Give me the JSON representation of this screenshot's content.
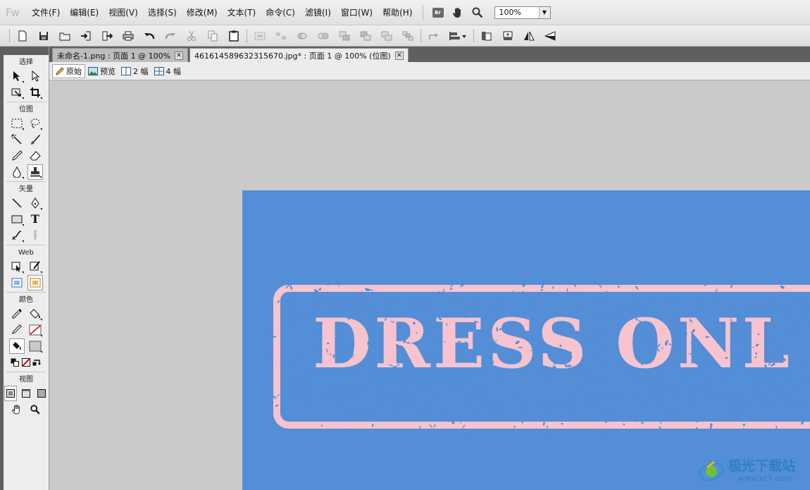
{
  "app": {
    "logo": "Fw"
  },
  "menubar": {
    "items": [
      {
        "label": "文件(F)"
      },
      {
        "label": "编辑(E)"
      },
      {
        "label": "视图(V)"
      },
      {
        "label": "选择(S)"
      },
      {
        "label": "修改(M)"
      },
      {
        "label": "文本(T)"
      },
      {
        "label": "命令(C)"
      },
      {
        "label": "滤镜(I)"
      },
      {
        "label": "窗口(W)"
      },
      {
        "label": "帮助(H)"
      }
    ],
    "br_label": "Br",
    "zoom": "100%"
  },
  "tools": {
    "sections": {
      "select": "选择",
      "bitmap": "位图",
      "vector": "矢量",
      "web": "Web",
      "colors": "颜色",
      "view": "视图"
    },
    "text_tool": "T"
  },
  "doc_tabs": [
    {
      "label": "未命名-1.png : 页面 1 @ 100%",
      "active": false
    },
    {
      "label": "461614589632315670.jpg* : 页面 1 @ 100% (位图)",
      "active": true
    }
  ],
  "view_tabs": [
    {
      "label": "原始",
      "active": true
    },
    {
      "label": "预览",
      "active": false
    },
    {
      "label": "2 幅",
      "active": false
    },
    {
      "label": "4 幅",
      "active": false
    }
  ],
  "canvas": {
    "stamp_text": "DRESS ONL",
    "bg_color": "#538ed6",
    "stamp_color": "#f6c3ce"
  },
  "watermark": {
    "title": "极光下载站",
    "url": "www.xz7.com"
  }
}
